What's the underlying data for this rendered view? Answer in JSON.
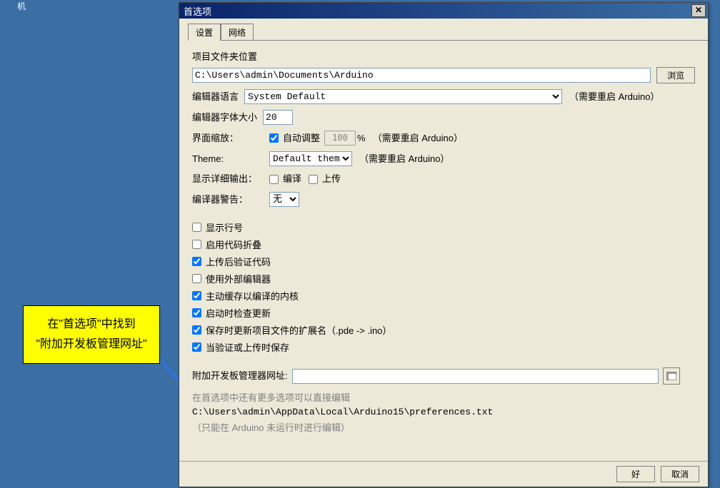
{
  "desktop": {
    "icon_label": "机"
  },
  "annotation": {
    "line1": "在\"首选项\"中找到",
    "line2": "\"附加开发板管理网址\""
  },
  "dialog": {
    "title": "首选项",
    "tabs": [
      "设置",
      "网络"
    ]
  },
  "fields": {
    "project_folder": {
      "label": "项目文件夹位置",
      "value": "C:\\Users\\admin\\Documents\\Arduino",
      "browse": "浏览"
    },
    "editor_language": {
      "label": "编辑器语言",
      "value": "System Default",
      "hint": "（需要重启 Arduino）"
    },
    "font_size": {
      "label": "编辑器字体大小",
      "value": "20"
    },
    "ui_scale": {
      "label": "界面缩放：",
      "auto_label": "自动调整",
      "percent": "100",
      "hint": "（需要重启 Arduino）"
    },
    "theme": {
      "label": "Theme:",
      "value": "Default theme",
      "hint": "（需要重启 Arduino）"
    },
    "verbose": {
      "label": "显示详细输出：",
      "compile": "编译",
      "upload": "上传"
    },
    "warnings": {
      "label": "编译器警告：",
      "value": "无"
    },
    "boards_url": {
      "label": "附加开发板管理器网址:",
      "value": ""
    }
  },
  "checks": [
    {
      "label": "显示行号",
      "checked": false
    },
    {
      "label": "启用代码折叠",
      "checked": false
    },
    {
      "label": "上传后验证代码",
      "checked": true
    },
    {
      "label": "使用外部编辑器",
      "checked": false
    },
    {
      "label": "主动缓存以编译的内核",
      "checked": true
    },
    {
      "label": "启动时检查更新",
      "checked": true
    },
    {
      "label": "保存时更新项目文件的扩展名（.pde -> .ino）",
      "checked": true
    },
    {
      "label": "当验证或上传时保存",
      "checked": true
    }
  ],
  "footer_text": {
    "more_prefs": "在首选项中还有更多选项可以直接编辑",
    "pref_path": "C:\\Users\\admin\\AppData\\Local\\Arduino15\\preferences.txt",
    "edit_closed": "（只能在 Arduino 未运行时进行编辑）"
  },
  "buttons": {
    "ok": "好",
    "cancel": "取消"
  }
}
